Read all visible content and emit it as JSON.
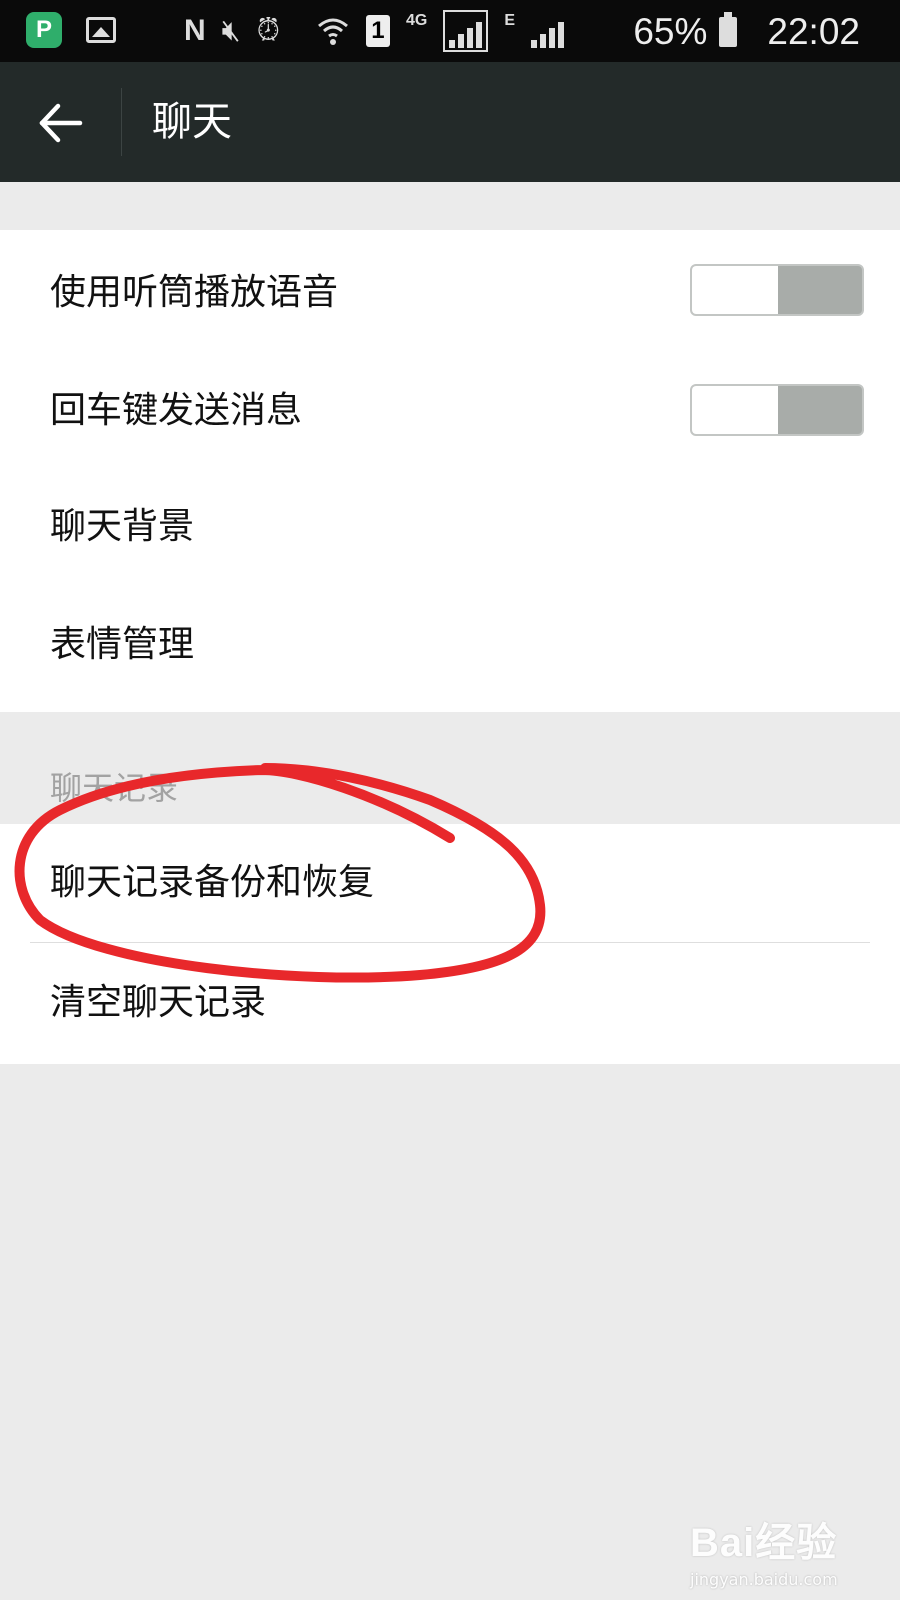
{
  "status_bar": {
    "app_icon_letter": "P",
    "sim_slot": "1",
    "network_label_1": "4G",
    "network_label_2": "E",
    "battery": "65%",
    "time": "22:02"
  },
  "header": {
    "title": "聊天"
  },
  "settings": {
    "items": [
      {
        "label": "使用听筒播放语音",
        "toggle": false
      },
      {
        "label": "回车键发送消息",
        "toggle": false
      },
      {
        "label": "聊天背景"
      },
      {
        "label": "表情管理"
      }
    ]
  },
  "chat_records": {
    "section_label": "聊天记录",
    "items": [
      {
        "label": "聊天记录备份和恢复"
      },
      {
        "label": "清空聊天记录"
      }
    ]
  },
  "colors": {
    "action_bar": "#232a29",
    "annotation": "#e8282b",
    "toggle_off": "#a8aca9",
    "background": "#ebebeb"
  },
  "watermark": {
    "main": "Bai经验",
    "sub": "jingyan.baidu.com"
  }
}
